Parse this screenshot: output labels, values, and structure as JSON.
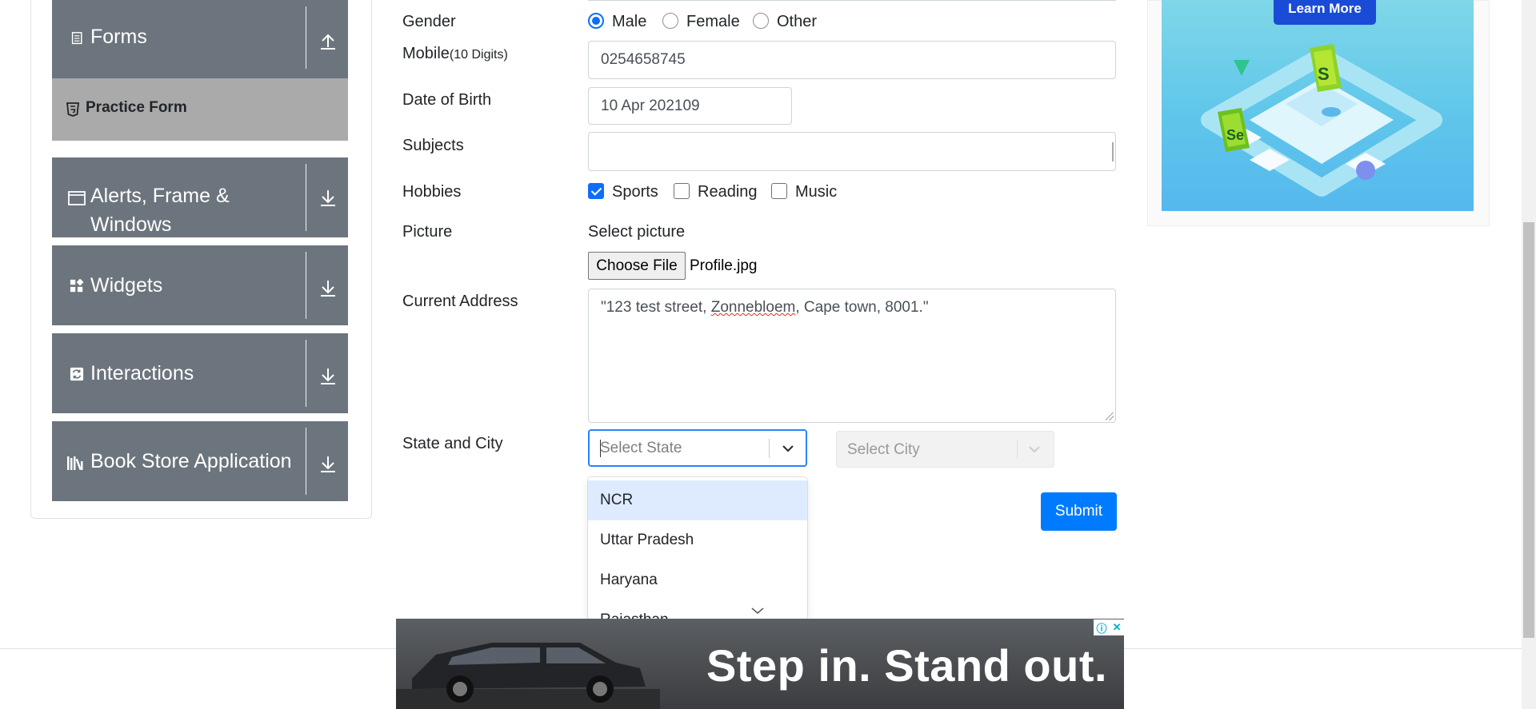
{
  "sidebar": {
    "groups": [
      {
        "label": "Forms",
        "icon": "form-icon",
        "arrow": "upload-arrow-icon"
      },
      {
        "label": "Alerts, Frame &",
        "label2": "Windows",
        "icon": "window-icon",
        "arrow": "download-arrow-icon"
      },
      {
        "label": "Widgets",
        "icon": "widgets-icon",
        "arrow": "download-arrow-icon"
      },
      {
        "label": "Interactions",
        "icon": "interactions-icon",
        "arrow": "download-arrow-icon"
      },
      {
        "label": "Book Store Application",
        "icon": "books-icon",
        "arrow": "download-arrow-icon"
      }
    ],
    "active_item": {
      "label": "Practice Form",
      "icon": "html5-icon"
    }
  },
  "form": {
    "gender": {
      "label": "Gender",
      "options": [
        "Male",
        "Female",
        "Other"
      ],
      "selected": "Male"
    },
    "mobile": {
      "label": "Mobile",
      "hint": "(10 Digits)",
      "value": "0254658745"
    },
    "dob": {
      "label": "Date of Birth",
      "value": "10 Apr 202109"
    },
    "subjects": {
      "label": "Subjects",
      "value": ""
    },
    "hobbies": {
      "label": "Hobbies",
      "options": [
        "Sports",
        "Reading",
        "Music"
      ],
      "checked": [
        "Sports"
      ]
    },
    "picture": {
      "label": "Picture",
      "prompt": "Select picture",
      "button": "Choose File",
      "file": "Profile.jpg"
    },
    "address": {
      "label": "Current Address",
      "value_pre": "\"123 test street, ",
      "value_spell": "Zonnebloem",
      "value_post": ", Cape town, 8001.\""
    },
    "state_city": {
      "label": "State and City",
      "state_placeholder": "Select State",
      "city_placeholder": "Select City",
      "state_options": [
        "NCR",
        "Uttar Pradesh",
        "Haryana",
        "Rajasthan"
      ],
      "focused_option": "NCR"
    },
    "submit_label": "Submit"
  },
  "ads": {
    "right": {
      "button": "Learn More"
    },
    "bottom": {
      "headline": "Step in. Stand out.",
      "info_icon": "ⓘ",
      "close_icon": "✕"
    }
  },
  "colors": {
    "primary": "#007bff",
    "sidebar": "#6c757d",
    "active_item": "#aaaaaa"
  }
}
